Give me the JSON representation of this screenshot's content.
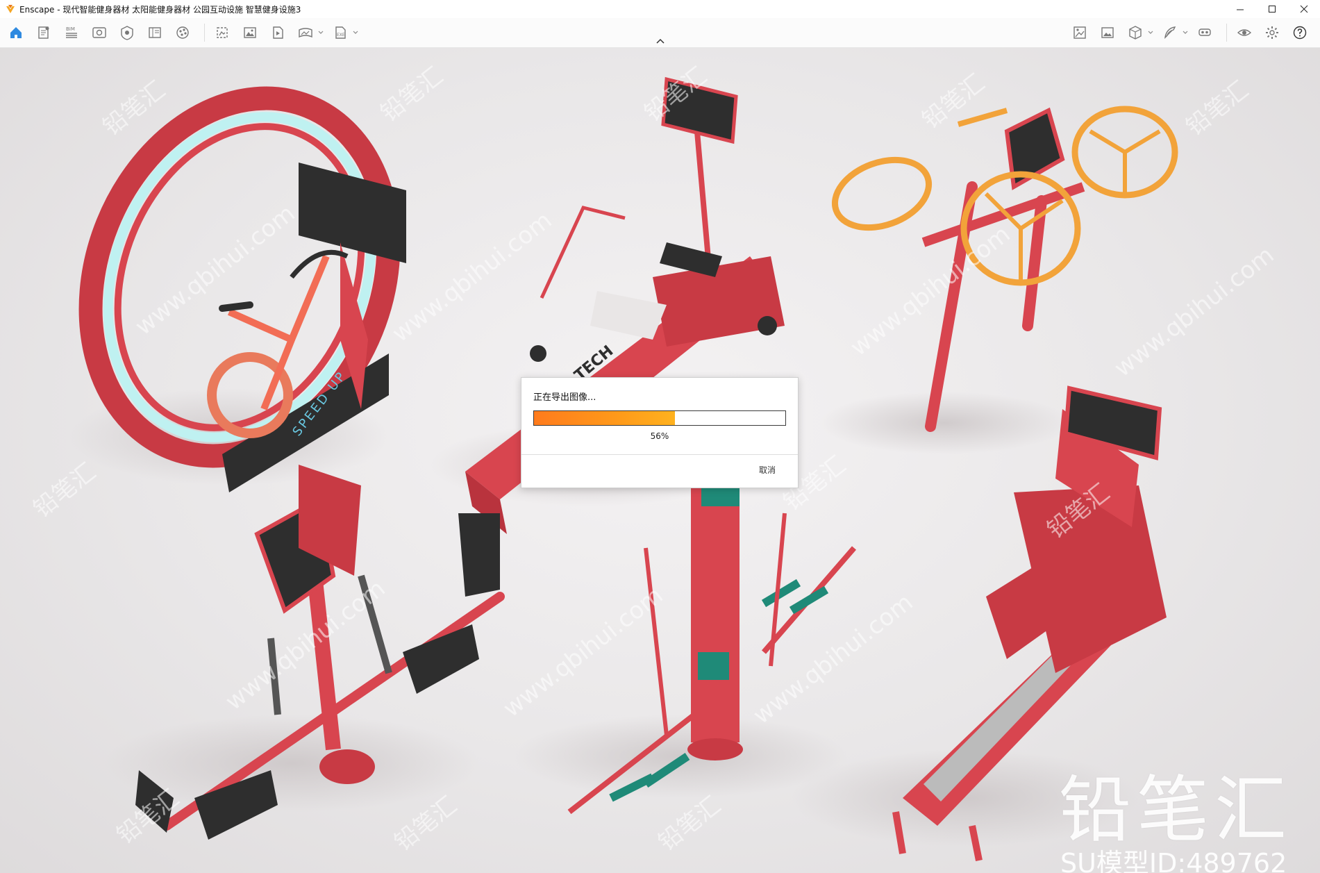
{
  "window": {
    "title": "Enscape - 现代智能健身器材 太阳能健身器材 公园互动设施 智慧健身设施3",
    "controls": [
      "minimize",
      "maximize",
      "close"
    ]
  },
  "toolbar": {
    "left_icons": [
      "home-icon",
      "document-icon",
      "bim-icon",
      "view-icon",
      "capture-icon",
      "book-icon",
      "materials-icon",
      "batch-render-icon",
      "image-icon",
      "video-icon",
      "panorama-icon",
      "exe-export-icon"
    ],
    "bim_label": "BIM",
    "exe_label": "EXE",
    "right_icons": [
      "asset-library-icon",
      "gallery-icon",
      "cube-icon",
      "feather-icon",
      "vr-icon",
      "eye-icon",
      "settings-icon",
      "help-icon"
    ]
  },
  "dialog": {
    "title": "正在导出图像...",
    "progress_percent": 56,
    "progress_label": "56%",
    "cancel_label": "取消"
  },
  "scene": {
    "equipment_labels": [
      "SPEED UP",
      "TECH"
    ]
  },
  "watermark": {
    "brand": "铅笔汇",
    "model_id": "SU模型ID:489762",
    "diagonal_text": [
      "铅笔汇",
      "www.qbihui.com"
    ]
  },
  "colors": {
    "equipment_red": "#d8454f",
    "accent_orange": "#f2a33a",
    "screen_dark": "#2e2e2e",
    "teal": "#1f8a78",
    "ring_glow": "#bff1f1",
    "progress_orange": "#ff8a1c"
  }
}
